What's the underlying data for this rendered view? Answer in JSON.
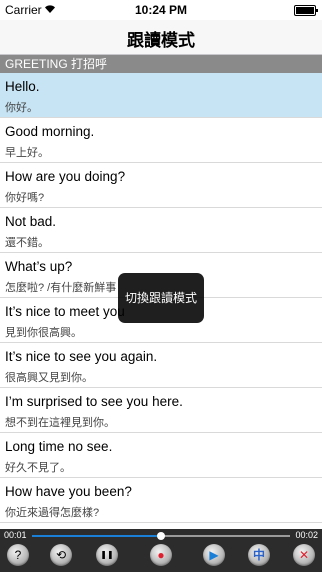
{
  "status_bar": {
    "carrier": "Carrier",
    "time": "10:24 PM"
  },
  "nav": {
    "title": "跟讀模式"
  },
  "section": {
    "header": "GREETING 打招呼"
  },
  "phrases": [
    {
      "en": "Hello.",
      "zh": "你好。",
      "selected": true
    },
    {
      "en": "Good morning.",
      "zh": "早上好。",
      "selected": false
    },
    {
      "en": "How are you doing?",
      "zh": "你好嗎?",
      "selected": false
    },
    {
      "en": "Not bad.",
      "zh": "還不錯。",
      "selected": false
    },
    {
      "en": "What’s up?",
      "zh": "怎麼啦? /有什麼新鮮事",
      "selected": false
    },
    {
      "en": "It’s nice to meet you",
      "zh": "見到你很高興。",
      "selected": false
    },
    {
      "en": "It’s nice to see you again.",
      "zh": "很高興又見到你。",
      "selected": false
    },
    {
      "en": "I’m surprised to see you here.",
      "zh": "想不到在這裡見到你。",
      "selected": false
    },
    {
      "en": "Long time no see.",
      "zh": "好久不見了。",
      "selected": false
    },
    {
      "en": "How have you been?",
      "zh": "你近來過得怎麼樣?",
      "selected": false
    }
  ],
  "toast": {
    "text": "切換跟讀模式"
  },
  "player": {
    "current_time": "00:01",
    "total_time": "00:02",
    "progress": 0.5,
    "buttons": [
      {
        "name": "help",
        "label": "?",
        "icon": "help-icon"
      },
      {
        "name": "repeat",
        "label": "⟲",
        "icon": "repeat-icon"
      },
      {
        "name": "pause",
        "label": "❚❚",
        "icon": "pause-icon"
      },
      {
        "name": "record",
        "label": "●",
        "icon": "record-icon"
      },
      {
        "name": "play",
        "label": "▶",
        "icon": "play-icon"
      },
      {
        "name": "chinese",
        "label": "中",
        "icon": "chinese-toggle-icon"
      },
      {
        "name": "shuffle-off",
        "label": "✕",
        "icon": "cross-icon"
      }
    ]
  },
  "colors": {
    "selected_row": "#c7e4f4",
    "section_header": "#8a8a8a",
    "record": "#e0202f",
    "play": "#1a7fd6",
    "chinese": "#2a62c9"
  }
}
